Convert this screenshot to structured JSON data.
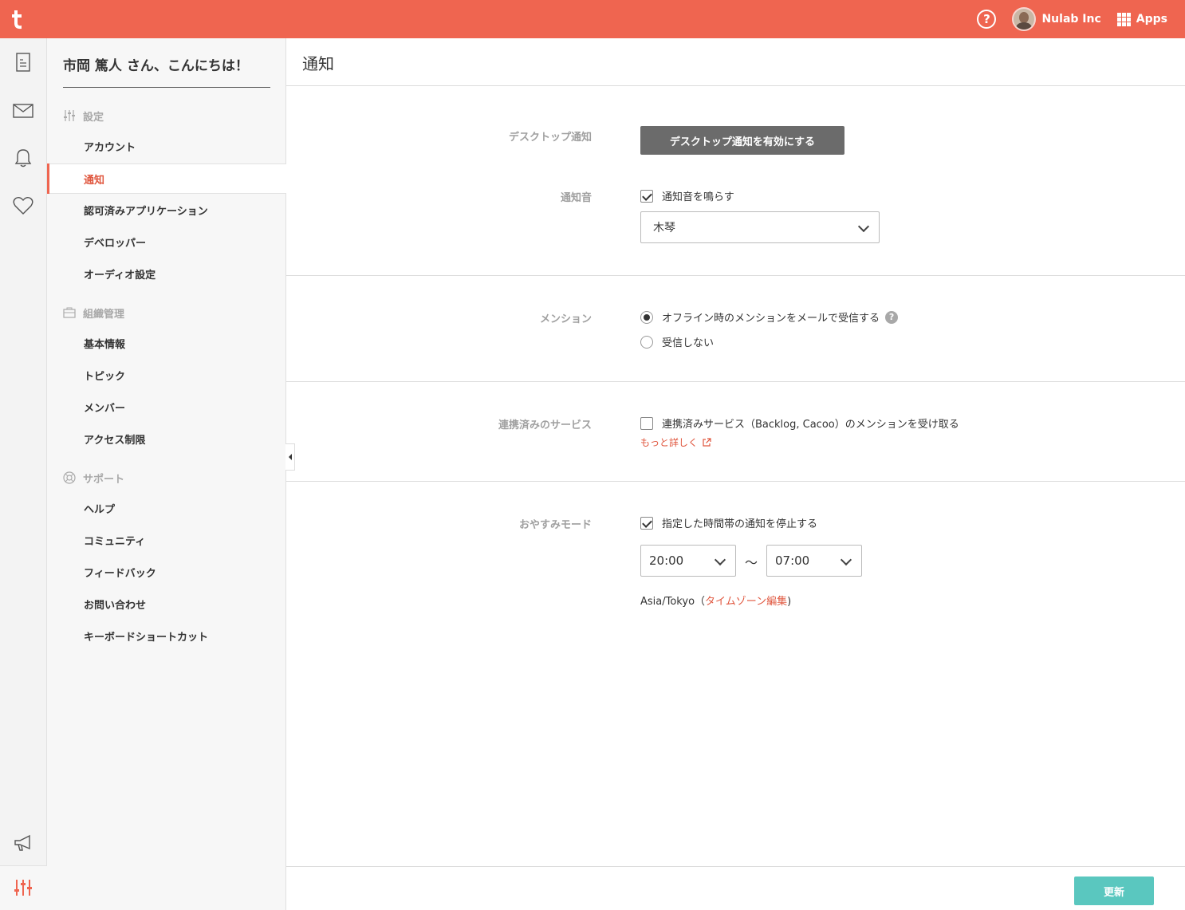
{
  "header": {
    "help_label": "?",
    "org_name": "Nulab Inc",
    "apps_label": "Apps"
  },
  "rail": {
    "icons": [
      "document-icon",
      "mail-icon",
      "bell-icon",
      "heart-icon",
      "megaphone-icon",
      "settings-sliders-icon"
    ]
  },
  "sidebar": {
    "greeting": "市岡 篤人 さん、こんにちは！",
    "sections": [
      {
        "title": "設定",
        "icon": "sliders-icon",
        "items": [
          {
            "label": "アカウント"
          },
          {
            "label": "通知",
            "active": true
          },
          {
            "label": "認可済みアプリケーション"
          },
          {
            "label": "デベロッパー"
          },
          {
            "label": "オーディオ設定"
          }
        ]
      },
      {
        "title": "組織管理",
        "icon": "briefcase-icon",
        "items": [
          {
            "label": "基本情報"
          },
          {
            "label": "トピック"
          },
          {
            "label": "メンバー"
          },
          {
            "label": "アクセス制限"
          }
        ]
      },
      {
        "title": "サポート",
        "icon": "lifebuoy-icon",
        "items": [
          {
            "label": "ヘルプ"
          },
          {
            "label": "コミュニティ"
          },
          {
            "label": "フィードバック"
          },
          {
            "label": "お問い合わせ"
          },
          {
            "label": "キーボードショートカット"
          }
        ]
      }
    ]
  },
  "main": {
    "title": "通知",
    "desktop": {
      "label": "デスクトップ通知",
      "button": "デスクトップ通知を有効にする"
    },
    "sound": {
      "label": "通知音",
      "checkbox_label": "通知音を鳴らす",
      "checked": true,
      "selected": "木琴"
    },
    "mention": {
      "label": "メンション",
      "options": [
        {
          "label": "オフライン時のメンションをメールで受信する",
          "selected": true
        },
        {
          "label": "受信しない",
          "selected": false
        }
      ]
    },
    "services": {
      "label": "連携済みのサービス",
      "checkbox_label": "連携済みサービス（Backlog, Cacoo）のメンションを受け取る",
      "checked": false,
      "more_link": "もっと詳しく"
    },
    "sleep": {
      "label": "おやすみモード",
      "checkbox_label": "指定した時間帯の通知を停止する",
      "checked": true,
      "from": "20:00",
      "separator": "〜",
      "to": "07:00",
      "timezone": "Asia/Tokyo",
      "tz_open": "（",
      "tz_link": "タイムゾーン編集",
      "tz_close": ")"
    },
    "update_button": "更新"
  },
  "colors": {
    "brand": "#ef6550",
    "link": "#e0573f",
    "update": "#5ac7bf",
    "desktop_button": "#6b6b6b"
  }
}
